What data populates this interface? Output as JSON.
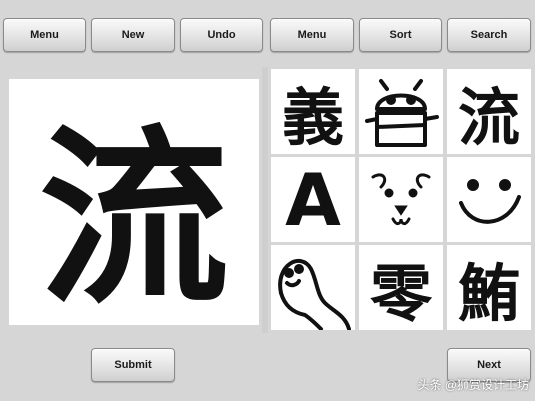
{
  "toolbar": {
    "buttons": [
      "Menu",
      "New",
      "Undo",
      "Menu",
      "Sort",
      "Search"
    ]
  },
  "canvas": {
    "glyph": "流"
  },
  "grid": {
    "items": [
      {
        "name": "glyph-yi",
        "glyph": "義"
      },
      {
        "name": "robot-drawing",
        "glyph": ""
      },
      {
        "name": "glyph-liu",
        "glyph": "流"
      },
      {
        "name": "letter-a",
        "glyph": "A"
      },
      {
        "name": "dog-face",
        "glyph": ""
      },
      {
        "name": "smiley-face",
        "glyph": ""
      },
      {
        "name": "ghost-drawing",
        "glyph": ""
      },
      {
        "name": "glyph-ling",
        "glyph": "零"
      },
      {
        "name": "glyph-wei",
        "glyph": "鮪"
      }
    ]
  },
  "footer": {
    "submit_label": "Submit",
    "next_label": "Next"
  },
  "watermark": {
    "text": "头条 @狮赏设计工坊"
  }
}
